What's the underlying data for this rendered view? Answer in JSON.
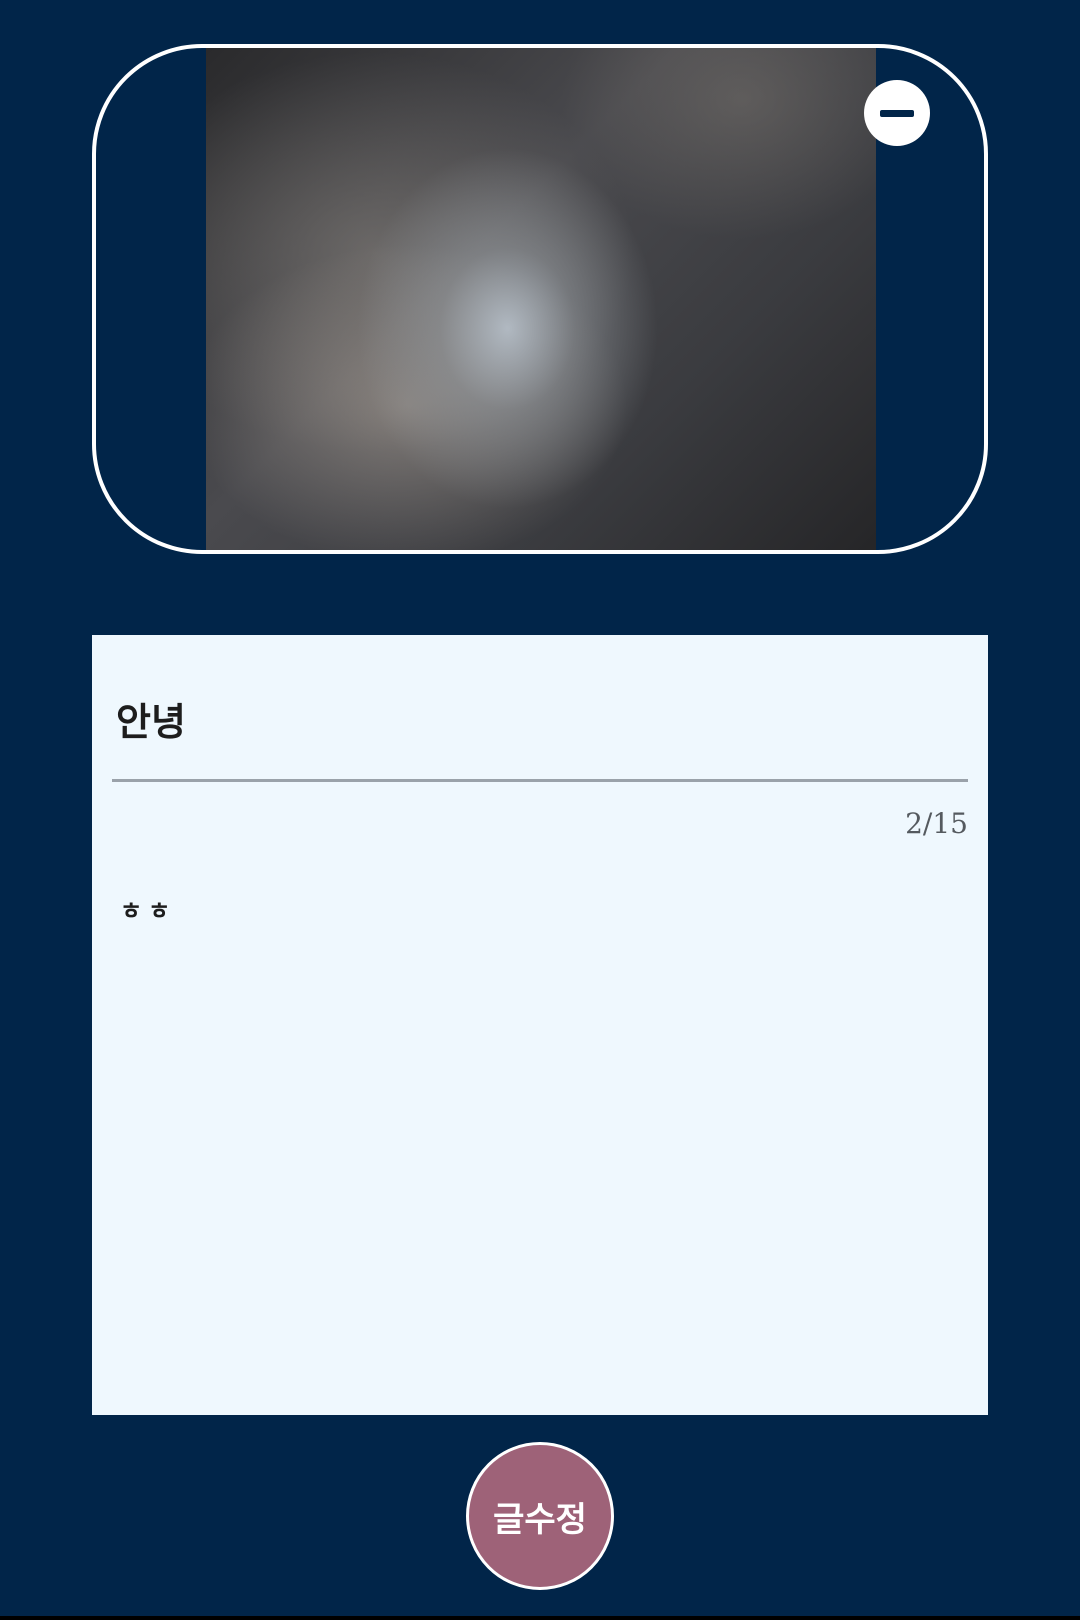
{
  "post": {
    "title": "안녕",
    "counter": "2/15",
    "body": "ㅎㅎ"
  },
  "actions": {
    "edit_label": "글수정",
    "remove_image_icon": "minus-icon"
  },
  "colors": {
    "background": "#012549",
    "card": "#eff8fe",
    "edit_button": "#9e6278",
    "frame": "#ffffff"
  }
}
